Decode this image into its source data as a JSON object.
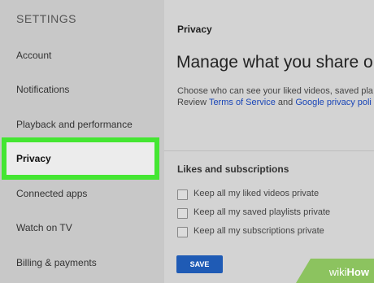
{
  "sidebar": {
    "header": "SETTINGS",
    "items": [
      {
        "label": "Account"
      },
      {
        "label": "Notifications"
      },
      {
        "label": "Playback and performance"
      },
      {
        "label": "Privacy"
      },
      {
        "label": "Connected apps"
      },
      {
        "label": "Watch on TV"
      },
      {
        "label": "Billing & payments"
      }
    ],
    "active_index": 3
  },
  "main": {
    "section_title": "Privacy",
    "headline": "Manage what you share on Y",
    "description": {
      "line1": "Choose who can see your liked videos, saved pla",
      "line2_prefix": "Review ",
      "terms_link": "Terms of Service",
      "line2_and": " and ",
      "privacy_link": "Google privacy poli"
    },
    "likes_section": {
      "title": "Likes and subscriptions",
      "options": [
        {
          "label": "Keep all my liked videos private",
          "checked": false
        },
        {
          "label": "Keep all my saved playlists private",
          "checked": false
        },
        {
          "label": "Keep all my subscriptions private",
          "checked": false
        }
      ]
    },
    "save_label": "SAVE"
  },
  "watermark": {
    "wiki": "wiki",
    "how": "How"
  },
  "colors": {
    "highlight": "#44e632",
    "link": "#1a46b8",
    "button": "#1f5bb5",
    "watermark": "#7fbf4a"
  }
}
